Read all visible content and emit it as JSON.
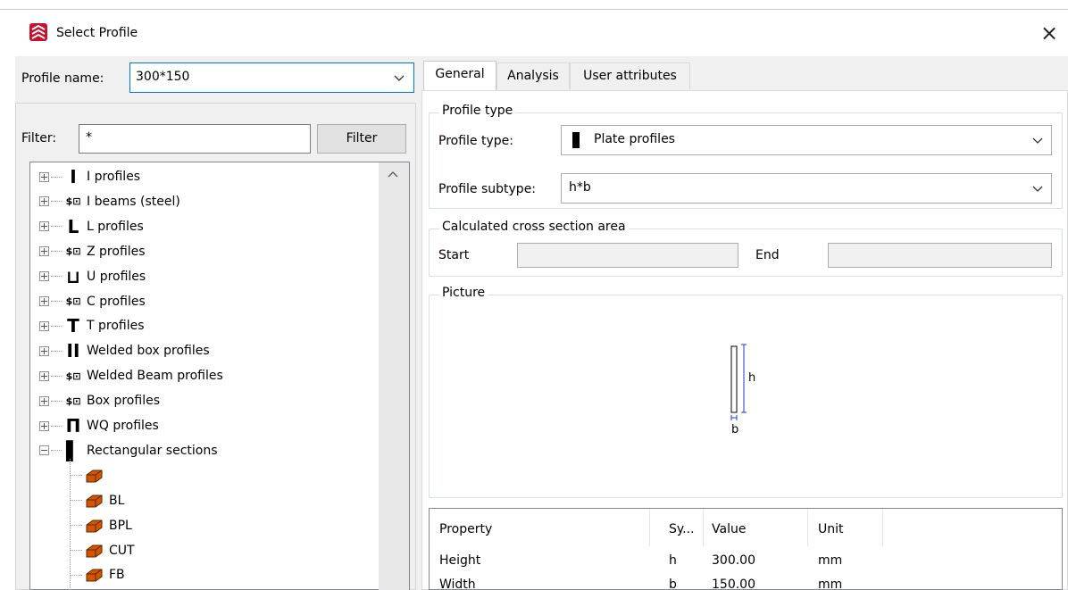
{
  "window": {
    "title": "Select Profile",
    "close_label": "×"
  },
  "profile_name": {
    "label": "Profile name:",
    "value": "300*150"
  },
  "filter": {
    "label": "Filter:",
    "value": "*",
    "button_label": "Filter"
  },
  "tree": {
    "groups": [
      {
        "label": "I profiles",
        "icon": "i-profile-icon",
        "glyph": "I"
      },
      {
        "label": "I beams (steel)",
        "icon": "parametric-profile-icon",
        "glyph": "$⊡"
      },
      {
        "label": "L profiles",
        "icon": "l-profile-icon",
        "glyph": "L"
      },
      {
        "label": "Z profiles",
        "icon": "parametric-profile-icon",
        "glyph": "$⊡"
      },
      {
        "label": "U profiles",
        "icon": "u-profile-icon",
        "glyph": "⊔"
      },
      {
        "label": "C profiles",
        "icon": "parametric-profile-icon",
        "glyph": "$⊡"
      },
      {
        "label": "T profiles",
        "icon": "t-profile-icon",
        "glyph": "T"
      },
      {
        "label": "Welded box profiles",
        "icon": "welded-box-icon",
        "glyph": "II"
      },
      {
        "label": "Welded Beam profiles",
        "icon": "parametric-profile-icon",
        "glyph": "$⊡"
      },
      {
        "label": "Box profiles",
        "icon": "parametric-profile-icon",
        "glyph": "$⊡"
      },
      {
        "label": "WQ profiles",
        "icon": "wq-profile-icon",
        "glyph": "Π"
      },
      {
        "label": "Rectangular sections",
        "icon": "plate-profile-icon",
        "glyph": "▌"
      }
    ],
    "children": [
      "",
      "BL",
      "BPL",
      "CUT",
      "FB"
    ]
  },
  "tabs": [
    "General",
    "Analysis",
    "User attributes"
  ],
  "general": {
    "profile_type_group": "Profile type",
    "profile_type_label": "Profile type:",
    "profile_type_value": "Plate profiles",
    "profile_subtype_label": "Profile subtype:",
    "profile_subtype_value": "h*b",
    "area_group": "Calculated cross section area",
    "start_label": "Start",
    "end_label": "End",
    "picture_group": "Picture",
    "picture_h": "h",
    "picture_b": "b"
  },
  "properties": {
    "headers": [
      "Property",
      "Sy...",
      "Value",
      "Unit"
    ],
    "rows": [
      [
        "Height",
        "h",
        "300.00",
        "mm"
      ],
      [
        "Width",
        "b",
        "150.00",
        "mm"
      ]
    ]
  },
  "colors": {
    "accent": "#0078d7",
    "dimension_line": "#1f3bd1",
    "icon_orange": "#d35400"
  }
}
